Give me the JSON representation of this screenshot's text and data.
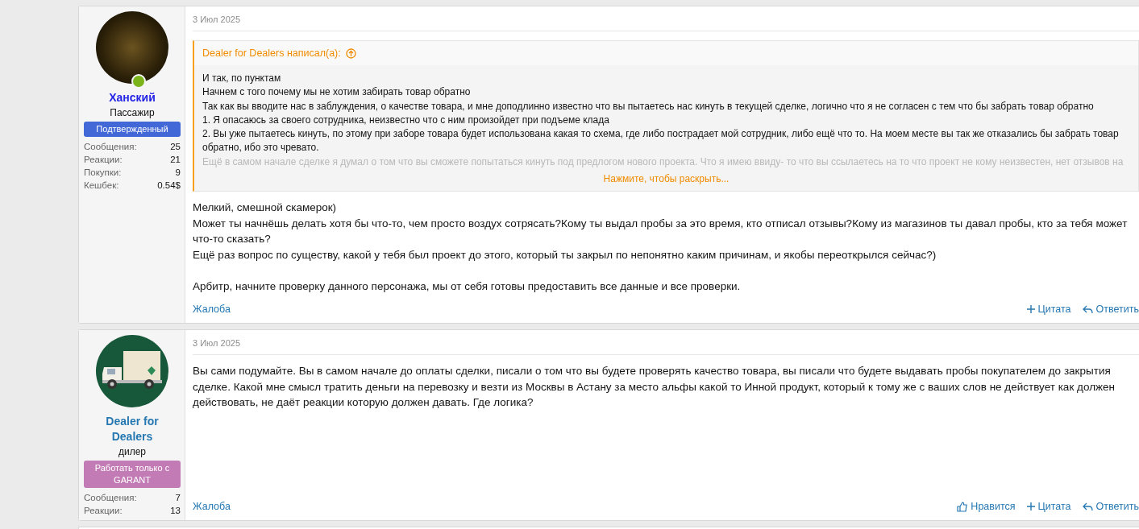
{
  "posts": [
    {
      "date": "3 Июл 2025",
      "author": {
        "avatar": {
          "kind": "photo"
        },
        "online": true,
        "name": "Ханский",
        "color": "#2323e6",
        "title": "Пассажир",
        "banner": {
          "text": "Подтвержденный",
          "color": "#4267d6"
        },
        "stats": [
          {
            "label": "Сообщения:",
            "value": "25"
          },
          {
            "label": "Реакции:",
            "value": "21"
          },
          {
            "label": "Покупки:",
            "value": "9"
          },
          {
            "label": "Кешбек:",
            "value": "0.54$"
          }
        ]
      },
      "quote": {
        "attribution": "Dealer for Dealers написал(а):",
        "lines": [
          "И так, по пунктам",
          "Начнем с того почему мы не хотим забирать товар обратно",
          "Так как вы вводите нас в заблуждения, о качестве товара, и мне доподлинно известно что вы пытаетесь нас кинуть в текущей сделке, логично что я не согласен с тем что бы забрать товар обратно",
          "1. Я опасаюсь за своего сотрудника, неизвестно что с ним произойдет при подъеме клада",
          "2. Вы уже пытаетесь кинуть, по этому при заборе товара будет использована какая то схема, где либо пострадает мой сотрудник, либо ещё что то. На моем месте вы так же отказались бы забрать товар обратно, ибо это чревато."
        ],
        "faded": "Ещё в самом начале сделке я думал о том что вы сможете попытаться кинуть под предлогом нового проекта. Что я имею ввиду- то что вы ссылаетесь на то что проект не кому неизвестен, нет отзывов на",
        "expand": "Нажмите, чтобы раскрыть..."
      },
      "body": [
        {
          "text": "Мелкий, смешной скамерок)",
          "spaced": false
        },
        {
          "text": "Может ты начнёшь делать хотя бы что-то, чем просто воздух сотрясать?Кому ты выдал пробы за это время, кто отписал отзывы?Кому из магазинов ты давал пробы, кто за тебя может что-то сказать?",
          "spaced": false
        },
        {
          "text": "Ещё раз вопрос по существу, какой у тебя был проект до этого, который ты закрыл по непонятно каким причинам, и якобы переоткрылся сейчас?)",
          "spaced": false
        },
        {
          "text": "Арбитр, начните проверку данного персонажа, мы от себя готовы предоставить все данные и все проверки.",
          "spaced": true
        }
      ],
      "report": "Жалоба",
      "actions": [
        {
          "kind": "quote",
          "label": "Цитата"
        },
        {
          "kind": "reply",
          "label": "Ответить"
        }
      ]
    },
    {
      "date": "3 Июл 2025",
      "author": {
        "avatar": {
          "kind": "truck"
        },
        "online": false,
        "name": "Dealer for Dealers",
        "color": "#2577b1",
        "title": "дилер",
        "banner": {
          "text": "Работать только с GARANT",
          "color": "#c27bb4"
        },
        "stats": [
          {
            "label": "Сообщения:",
            "value": "7"
          },
          {
            "label": "Реакции:",
            "value": "13"
          }
        ]
      },
      "body": [
        {
          "text": "Вы сами подумайте. Вы в самом начале до оплаты сделки, писали о том что вы будете проверять качество товара, вы писали что будете выдавать пробы покупателем до закрытия сделке. Какой мне смысл тратить деньги на перевозку и везти из Москвы в Астану за место альфы какой то Инной продукт, который к тому же с ваших слов не действует как должен действовать, не даёт реакции которую должен давать. Где логика?",
          "spaced": false
        }
      ],
      "report": "Жалоба",
      "actions": [
        {
          "kind": "like",
          "label": "Нравится"
        },
        {
          "kind": "quote",
          "label": "Цитата"
        },
        {
          "kind": "reply",
          "label": "Ответить"
        }
      ]
    }
  ]
}
